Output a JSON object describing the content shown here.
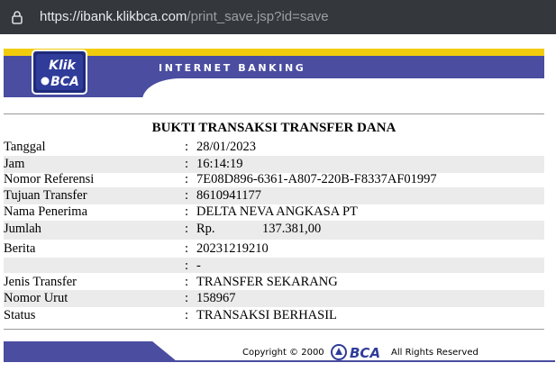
{
  "browser": {
    "url_host": "https://ibank.klikbca.com",
    "url_path": "/print_save.jsp?id=save"
  },
  "header": {
    "banner_text": "INTERNET BANKING",
    "logo_line1": "Klik",
    "logo_line2": "BCA"
  },
  "receipt": {
    "title": "BUKTI TRANSAKSI TRANSFER DANA",
    "rows": [
      {
        "label": "Tanggal",
        "value": "28/01/2023"
      },
      {
        "label": "Jam",
        "value": "16:14:19"
      },
      {
        "label": "Nomor Referensi",
        "value": "7E08D896-6361-A807-220B-F8337AF01997"
      },
      {
        "label": "Tujuan Transfer",
        "value": "8610941177"
      },
      {
        "label": "Nama Penerima",
        "value": "DELTA NEVA ANGKASA PT"
      },
      {
        "label": "Jumlah",
        "currency": "Rp.",
        "value": "137.381,00"
      },
      {
        "label": "Berita",
        "value": "20231219210"
      },
      {
        "label": "",
        "value": "-"
      },
      {
        "label": "Jenis Transfer",
        "value": "TRANSFER SEKARANG"
      },
      {
        "label": "Nomor Urut",
        "value": "158967"
      },
      {
        "label": "Status",
        "value": "TRANSAKSI BERHASIL"
      }
    ]
  },
  "footer": {
    "copyright": "Copyright © 2000",
    "brand": "BCA",
    "rights": "All Rights Reserved"
  },
  "colors": {
    "brand_blue": "#4a4da0",
    "brand_yellow": "#f2cc0c",
    "row_shade": "#ebebeb"
  }
}
